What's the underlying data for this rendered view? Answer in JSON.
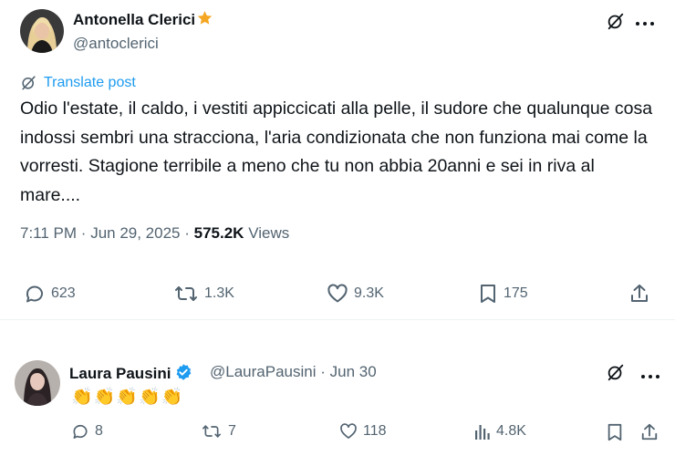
{
  "post1": {
    "author_name": "Antonella Clerici",
    "handle": "@antoclerici",
    "translate_label": "Translate post",
    "text": "Odio l'estate, il caldo, i vestiti appiccicati alla pelle, il sudore che qualunque cosa indossi sembri una straccionа, l'aria condizionata che non funziona mai come la vorresti. Stagione terribile a meno che tu non abbia 20anni e sei in riva al mare....",
    "time": "7:11 PM",
    "date": "Jun 29, 2025",
    "views_count": "575.2K",
    "views_label": "Views",
    "replies": "623",
    "reposts": "1.3K",
    "likes": "9.3K",
    "bookmarks": "175"
  },
  "post2": {
    "author_name": "Laura Pausini",
    "handle": "@LauraPausini",
    "date": "Jun 30",
    "emoji": [
      "👏",
      "👏",
      "👏",
      "👏",
      "👏"
    ],
    "replies": "8",
    "reposts": "7",
    "likes": "118",
    "views": "4.8K"
  },
  "colors": {
    "accent": "#1d9bf0",
    "star": "#f5a623",
    "verified": "#1d9bf0",
    "muted": "#536471"
  },
  "icons": [
    "star-icon",
    "verified-badge-icon",
    "grok-icon",
    "more-icon",
    "translate-icon",
    "reply-icon",
    "repost-icon",
    "like-icon",
    "views-icon",
    "bookmark-icon",
    "share-icon"
  ]
}
